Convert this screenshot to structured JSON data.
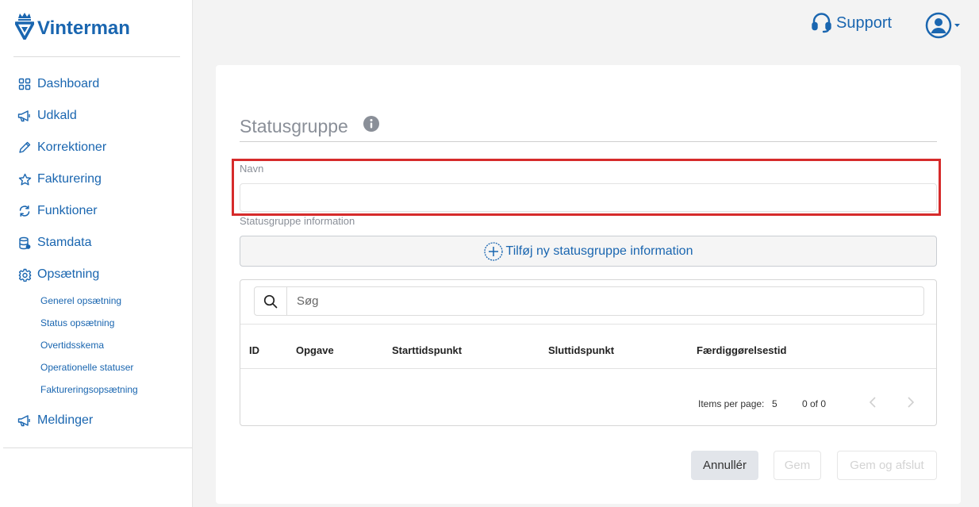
{
  "app": {
    "name": "Vinterman"
  },
  "sidebar": {
    "items": [
      {
        "label": "Dashboard",
        "icon": "grid-icon"
      },
      {
        "label": "Udkald",
        "icon": "megaphone-icon"
      },
      {
        "label": "Korrektioner",
        "icon": "pencil-icon"
      },
      {
        "label": "Fakturering",
        "icon": "star-icon"
      },
      {
        "label": "Funktioner",
        "icon": "refresh-icon"
      },
      {
        "label": "Stamdata",
        "icon": "database-icon"
      },
      {
        "label": "Opsætning",
        "icon": "gear-icon"
      }
    ],
    "subitems": [
      {
        "label": "Generel opsætning"
      },
      {
        "label": "Status opsætning"
      },
      {
        "label": "Overtidsskema"
      },
      {
        "label": "Operationelle statuser"
      },
      {
        "label": "Faktureringsopsætning"
      }
    ],
    "last_item": {
      "label": "Meldinger",
      "icon": "megaphone-icon"
    }
  },
  "header": {
    "support_label": "Support"
  },
  "form": {
    "title": "Statusgruppe",
    "navn_label": "Navn",
    "navn_value": "",
    "info_label": "Statusgruppe information",
    "add_label": "Tilføj ny statusgruppe information"
  },
  "table": {
    "search_placeholder": "Søg",
    "columns": [
      "ID",
      "Opgave",
      "Starttidspunkt",
      "Sluttidspunkt",
      "Færdiggørelsestid"
    ],
    "rows": [],
    "items_per_page_label": "Items per page:",
    "items_per_page_value": "5",
    "range_label": "0 of 0"
  },
  "actions": {
    "cancel": "Annullér",
    "save": "Gem",
    "save_close": "Gem og afslut"
  },
  "colors": {
    "accent": "#1a66b0",
    "highlight": "#d62b2b",
    "disabled_text": "#d3d3d3"
  }
}
